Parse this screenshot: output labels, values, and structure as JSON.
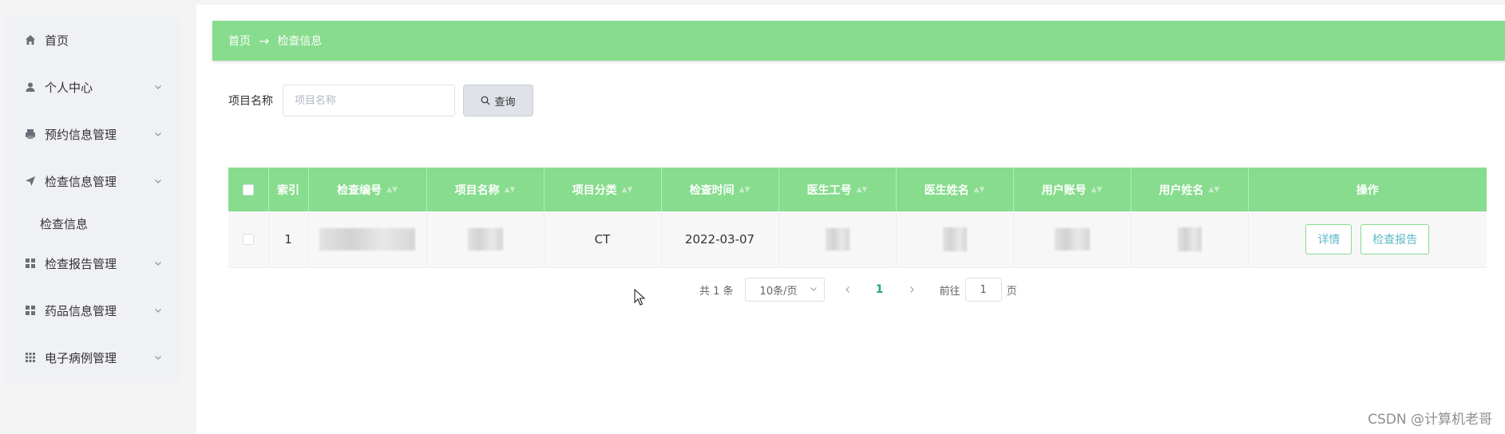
{
  "sidebar": {
    "items": [
      {
        "label": "首页",
        "icon": "home-icon",
        "has_arrow": false
      },
      {
        "label": "个人中心",
        "icon": "user-icon",
        "has_arrow": true
      },
      {
        "label": "预约信息管理",
        "icon": "printer-icon",
        "has_arrow": true
      },
      {
        "label": "检查信息管理",
        "icon": "send-icon",
        "has_arrow": true,
        "expanded": true
      },
      {
        "label": "检查报告管理",
        "icon": "grid-icon",
        "has_arrow": true
      },
      {
        "label": "药品信息管理",
        "icon": "grid-icon",
        "has_arrow": true
      },
      {
        "label": "电子病例管理",
        "icon": "apps-icon",
        "has_arrow": true
      }
    ],
    "submenu": {
      "label": "检查信息"
    }
  },
  "breadcrumb": {
    "home": "首页",
    "separator": "→",
    "current": "检查信息"
  },
  "search": {
    "label": "项目名称",
    "placeholder": "项目名称",
    "value": "",
    "button_label": "查询"
  },
  "table": {
    "columns": [
      "索引",
      "检查编号",
      "项目名称",
      "项目分类",
      "检查时间",
      "医生工号",
      "医生姓名",
      "用户账号",
      "用户姓名",
      "操作"
    ],
    "rows": [
      {
        "index": "1",
        "category": "CT",
        "time": "2022-03-07",
        "actions": [
          "详情",
          "检查报告"
        ]
      }
    ]
  },
  "pagination": {
    "total": "共 1 条",
    "page_size": "10条/页",
    "current_page": "1",
    "jump_label": "前往",
    "jump_value": "1",
    "jump_suffix": "页"
  },
  "watermark": "CSDN @计算机老哥",
  "colors": {
    "accent": "#87dc8d",
    "page_bg": "#f4f4f5",
    "active_page": "#2aa96b",
    "op_text": "#5cb8c8"
  }
}
